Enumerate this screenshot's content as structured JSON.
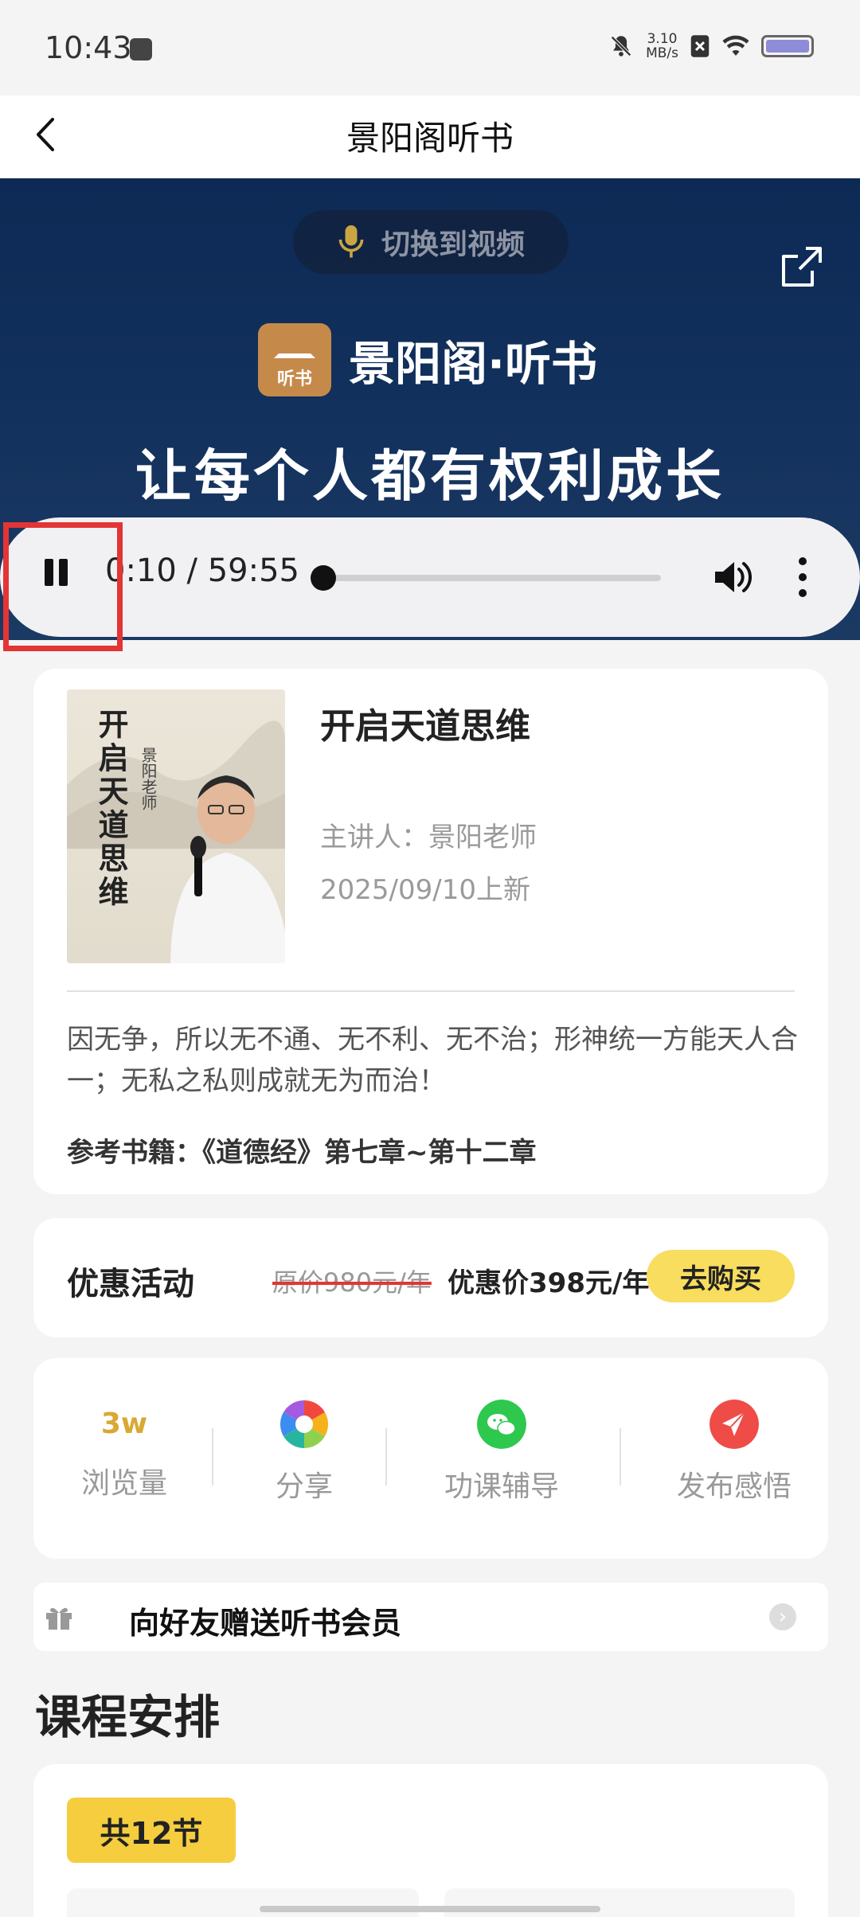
{
  "status_bar": {
    "time": "10:43",
    "speed_value": "3.10",
    "speed_unit": "MB/s"
  },
  "nav": {
    "title": "景阳阁听书"
  },
  "banner": {
    "switch_label": "切换到视频",
    "logo_label": "听书",
    "brand": "景阳阁·听书",
    "slogan": "让每个人都有权利成长"
  },
  "player": {
    "time": "0:10 / 59:55",
    "progress": 0.003
  },
  "book": {
    "cover_title": "开启天道思维",
    "cover_subtitle": "景阳老师",
    "title": "开启天道思维",
    "speaker": "主讲人：景阳老师",
    "date": "2025/09/10上新",
    "description": "因无争，所以无不通、无不利、无不治；形神统一方能天人合一；无私之私则成就无为而治！",
    "reference": "参考书籍：《道德经》第七章~第十二章"
  },
  "promo": {
    "label": "优惠活动",
    "original_price": "原价980元/年",
    "discount_price": "优惠价398元/年",
    "buy_button": "去购买"
  },
  "stats": {
    "views_value": "3w",
    "views_label": "浏览量",
    "share_label": "分享",
    "tutor_label": "功课辅导",
    "post_label": "发布感悟"
  },
  "gift": {
    "text": "向好友赠送听书会员"
  },
  "schedule": {
    "title": "课程安排",
    "total": "共12节"
  },
  "colors": {
    "accent_yellow": "#f5cd3f",
    "button_yellow": "#f8dd5e",
    "banner_navy": "#0d2a55",
    "highlight_red": "#e33535"
  }
}
